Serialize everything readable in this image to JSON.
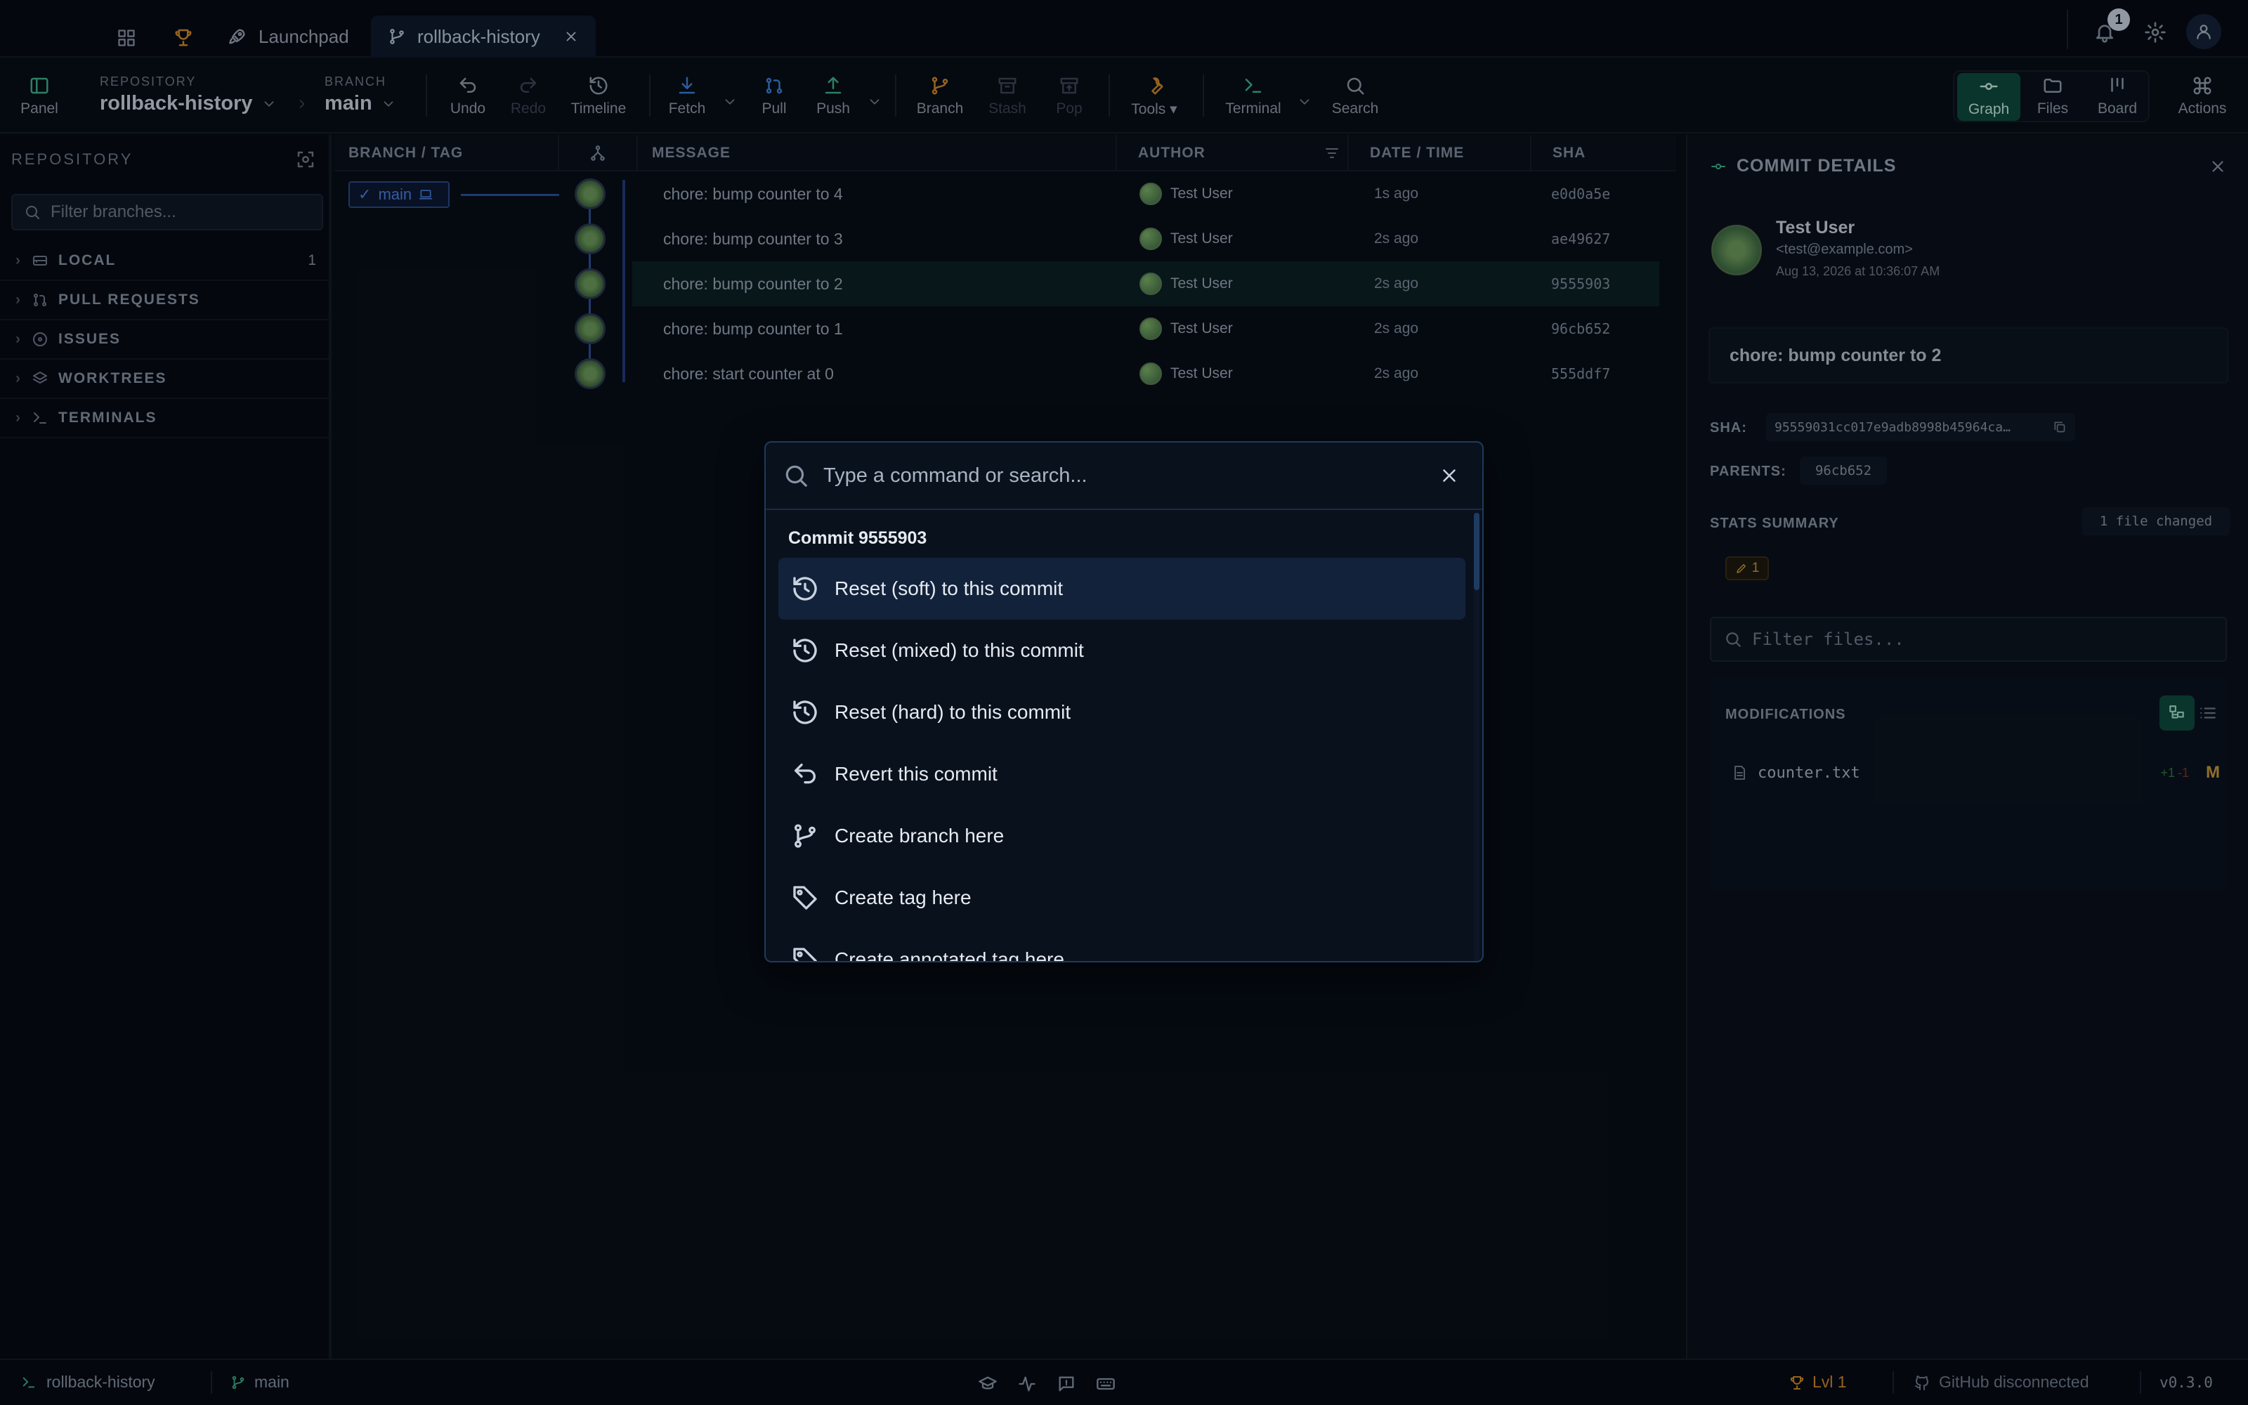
{
  "tabbar": {
    "tabs": [
      {
        "label": "Launchpad",
        "icon": "rocket-icon"
      },
      {
        "label": "rollback-history",
        "icon": "branch-icon",
        "active": true
      }
    ],
    "notification_count": "1"
  },
  "toolbar": {
    "panel_label": "Panel",
    "repository_caption": "REPOSITORY",
    "repository_name": "rollback-history",
    "branch_caption": "BRANCH",
    "branch_name": "main",
    "undo": "Undo",
    "redo": "Redo",
    "timeline": "Timeline",
    "fetch": "Fetch",
    "pull": "Pull",
    "push": "Push",
    "branch": "Branch",
    "stash": "Stash",
    "pop": "Pop",
    "tools": "Tools",
    "terminal": "Terminal",
    "search": "Search",
    "graph": "Graph",
    "files": "Files",
    "board": "Board",
    "actions": "Actions"
  },
  "sidebar": {
    "title": "REPOSITORY",
    "filter_placeholder": "Filter branches...",
    "sections": [
      {
        "label": "LOCAL",
        "count": "1",
        "icon": "hard-drive-icon"
      },
      {
        "label": "PULL REQUESTS",
        "count": "",
        "icon": "pull-request-icon"
      },
      {
        "label": "ISSUES",
        "count": "",
        "icon": "issue-icon"
      },
      {
        "label": "WORKTREES",
        "count": "",
        "icon": "layers-icon"
      },
      {
        "label": "TERMINALS",
        "count": "",
        "icon": "terminal-icon"
      }
    ]
  },
  "graph": {
    "columns": {
      "branch_tag": "BRANCH / TAG",
      "message": "MESSAGE",
      "author": "AUTHOR",
      "date_time": "DATE / TIME",
      "sha": "SHA"
    },
    "branch_label": "main",
    "commits": [
      {
        "message": "chore: bump counter to 4",
        "author": "Test User",
        "time": "1s ago",
        "sha": "e0d0a5e"
      },
      {
        "message": "chore: bump counter to 3",
        "author": "Test User",
        "time": "2s ago",
        "sha": "ae49627"
      },
      {
        "message": "chore: bump counter to 2",
        "author": "Test User",
        "time": "2s ago",
        "sha": "9555903",
        "selected": true
      },
      {
        "message": "chore: bump counter to 1",
        "author": "Test User",
        "time": "2s ago",
        "sha": "96cb652"
      },
      {
        "message": "chore: start counter at 0",
        "author": "Test User",
        "time": "2s ago",
        "sha": "555ddf7"
      }
    ]
  },
  "details": {
    "title": "COMMIT DETAILS",
    "author_name": "Test User",
    "author_email": "<test@example.com>",
    "date": "Aug 13, 2026 at 10:36:07 AM",
    "message": "chore: bump counter to 2",
    "sha_label": "SHA:",
    "sha_value": "95559031cc017e9adb8998b45964ca…",
    "parents_label": "PARENTS:",
    "parent_sha": "96cb652",
    "stats_label": "STATS SUMMARY",
    "files_changed": "1 file changed",
    "modified_count": "1",
    "filter_placeholder": "Filter files...",
    "modifications_label": "MODIFICATIONS",
    "files": [
      {
        "name": "counter.txt",
        "added": "+1",
        "removed": "-1",
        "status": "M"
      }
    ]
  },
  "statusbar": {
    "repo": "rollback-history",
    "branch": "main",
    "level": "Lvl 1",
    "github": "GitHub disconnected",
    "version": "v0.3.0"
  },
  "palette": {
    "placeholder": "Type a command or search...",
    "group_label": "Commit 9555903",
    "items": [
      {
        "label": "Reset (soft) to this commit",
        "icon": "reset-icon"
      },
      {
        "label": "Reset (mixed) to this commit",
        "icon": "reset-icon"
      },
      {
        "label": "Reset (hard) to this commit",
        "icon": "reset-icon"
      },
      {
        "label": "Revert this commit",
        "icon": "revert-icon"
      },
      {
        "label": "Create branch here",
        "icon": "branch-icon"
      },
      {
        "label": "Create tag here",
        "icon": "tag-icon"
      },
      {
        "label": "Create annotated tag here",
        "icon": "tag-icon"
      }
    ]
  },
  "colors": {
    "accent": "#3fb28a",
    "selection": "#13223b",
    "added": "#3fb950",
    "removed": "#f85149",
    "modified": "#e3a42b"
  }
}
